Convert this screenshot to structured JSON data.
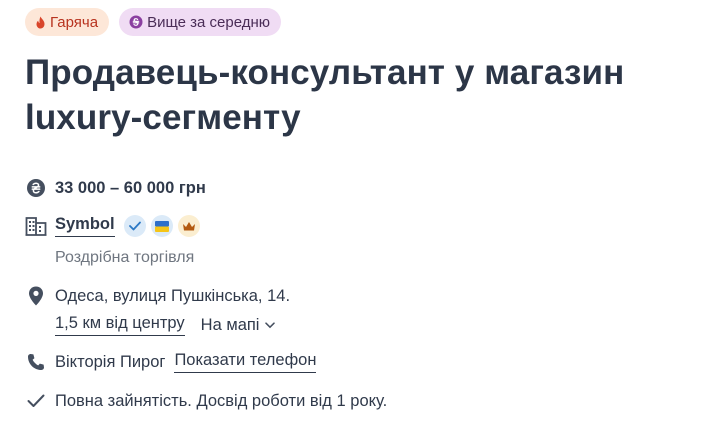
{
  "badges": {
    "hot": "Гаряча",
    "salary": "Вище за середню"
  },
  "title": "Продавець-консультант у магазин luxury-сегменту",
  "salary": "33 000 – 60 000 грн",
  "company": {
    "name": "Symbol",
    "industry": "Роздрібна торгівля"
  },
  "location": {
    "address": "Одеса, вулиця Пушкінська, 14.",
    "distance": "1,5 км від центру",
    "map_link": "На мапі"
  },
  "contact": {
    "name": "Вікторія Пирог",
    "phone_link": "Показати телефон"
  },
  "conditions": "Повна зайнятість. Досвід роботи від 1 року.",
  "colors": {
    "hot_bg": "#fde7d8",
    "hot_text": "#b8331f",
    "salary_bg": "#f0dcf4",
    "salary_icon": "#8a3fa0",
    "verified": "#2b78c5",
    "flag_blue": "#2d6fc9",
    "flag_yellow": "#f5c518",
    "crown": "#b35a10"
  }
}
